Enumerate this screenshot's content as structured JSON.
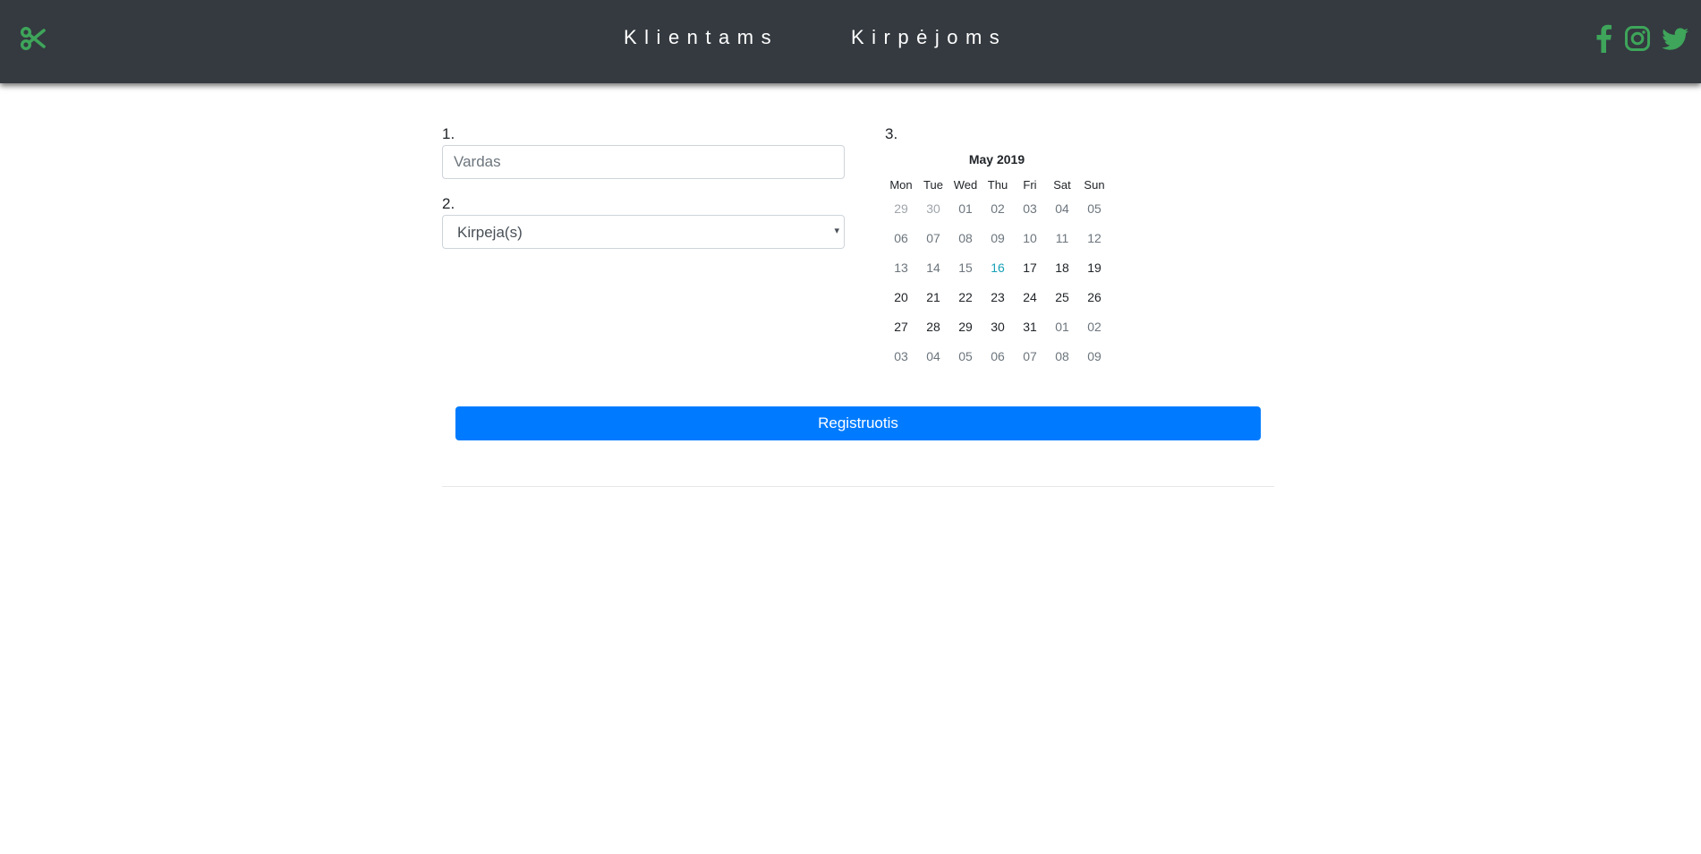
{
  "nav": {
    "logo_icon": "scissors-icon",
    "links": [
      "Klientams",
      "Kirpėjoms"
    ],
    "social": [
      "facebook-icon",
      "instagram-icon",
      "twitter-icon"
    ],
    "accent_color": "#3ea55a"
  },
  "form": {
    "step1_label": "1.",
    "name_placeholder": "Vardas",
    "step2_label": "2.",
    "barber_select_value": "Kirpeja(s)",
    "step3_label": "3."
  },
  "calendar": {
    "title": "May 2019",
    "weekdays": [
      "Mon",
      "Tue",
      "Wed",
      "Thu",
      "Fri",
      "Sat",
      "Sun"
    ],
    "weeks": [
      [
        {
          "d": "29",
          "s": "other"
        },
        {
          "d": "30",
          "s": "other"
        },
        {
          "d": "01",
          "s": "past"
        },
        {
          "d": "02",
          "s": "past"
        },
        {
          "d": "03",
          "s": "past"
        },
        {
          "d": "04",
          "s": "past"
        },
        {
          "d": "05",
          "s": "past"
        }
      ],
      [
        {
          "d": "06",
          "s": "past"
        },
        {
          "d": "07",
          "s": "past"
        },
        {
          "d": "08",
          "s": "past"
        },
        {
          "d": "09",
          "s": "past"
        },
        {
          "d": "10",
          "s": "past"
        },
        {
          "d": "11",
          "s": "past"
        },
        {
          "d": "12",
          "s": "past"
        }
      ],
      [
        {
          "d": "13",
          "s": "past"
        },
        {
          "d": "14",
          "s": "past"
        },
        {
          "d": "15",
          "s": "past"
        },
        {
          "d": "16",
          "s": "today"
        },
        {
          "d": "17",
          "s": "avail"
        },
        {
          "d": "18",
          "s": "avail"
        },
        {
          "d": "19",
          "s": "avail"
        }
      ],
      [
        {
          "d": "20",
          "s": "avail"
        },
        {
          "d": "21",
          "s": "avail"
        },
        {
          "d": "22",
          "s": "avail"
        },
        {
          "d": "23",
          "s": "avail"
        },
        {
          "d": "24",
          "s": "avail"
        },
        {
          "d": "25",
          "s": "avail"
        },
        {
          "d": "26",
          "s": "avail"
        }
      ],
      [
        {
          "d": "27",
          "s": "avail"
        },
        {
          "d": "28",
          "s": "avail"
        },
        {
          "d": "29",
          "s": "avail"
        },
        {
          "d": "30",
          "s": "avail"
        },
        {
          "d": "31",
          "s": "avail"
        },
        {
          "d": "01",
          "s": "past"
        },
        {
          "d": "02",
          "s": "past"
        }
      ],
      [
        {
          "d": "03",
          "s": "past"
        },
        {
          "d": "04",
          "s": "past"
        },
        {
          "d": "05",
          "s": "past"
        },
        {
          "d": "06",
          "s": "past"
        },
        {
          "d": "07",
          "s": "past"
        },
        {
          "d": "08",
          "s": "past"
        },
        {
          "d": "09",
          "s": "past"
        }
      ]
    ]
  },
  "register_button": "Registruotis"
}
